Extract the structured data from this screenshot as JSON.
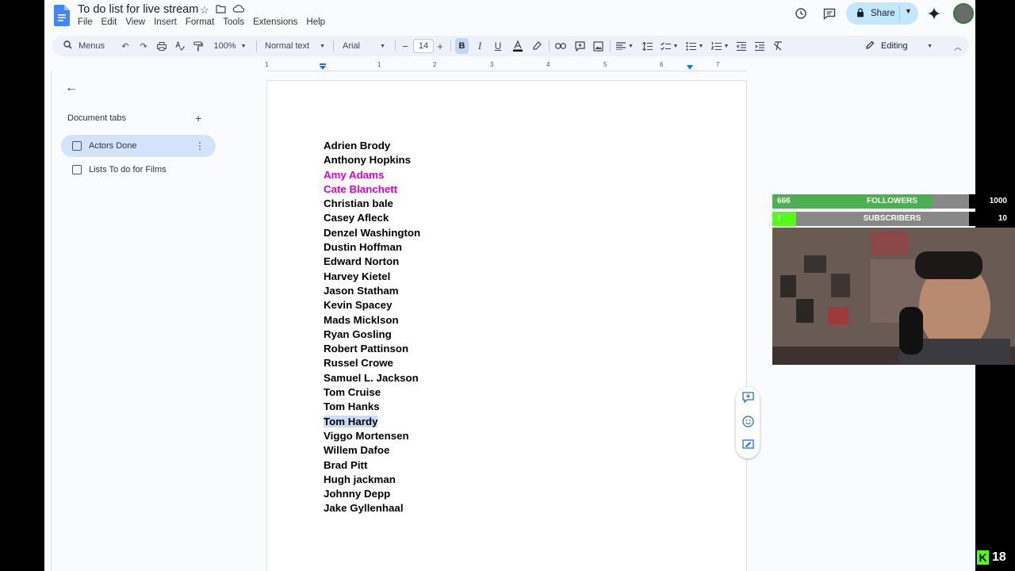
{
  "doc": {
    "title": "To do list for live stream",
    "menu": [
      "File",
      "Edit",
      "View",
      "Insert",
      "Format",
      "Tools",
      "Extensions",
      "Help"
    ]
  },
  "header": {
    "share_label": "Share"
  },
  "toolbar": {
    "search_label": "Menus",
    "zoom": "100%",
    "style": "Normal text",
    "font": "Arial",
    "font_size": "14",
    "mode": "Editing"
  },
  "ruler": {
    "ticks": [
      "1",
      "1",
      "2",
      "3",
      "4",
      "5",
      "6",
      "7"
    ]
  },
  "sidepanel": {
    "back": "←",
    "heading": "Document tabs",
    "add": "+",
    "tabs": [
      "Actors Done",
      "Lists To do for Films"
    ]
  },
  "content": {
    "actors": [
      {
        "name": "Adrien Brody",
        "color": "#000000"
      },
      {
        "name": "Anthony Hopkins",
        "color": "#000000"
      },
      {
        "name": "Amy Adams",
        "color": "#e000d4"
      },
      {
        "name": "Cate Blanchett",
        "color": "#e000d4"
      },
      {
        "name": "Christian bale",
        "color": "#000000"
      },
      {
        "name": "Casey Afleck",
        "color": "#000000"
      },
      {
        "name": "Denzel Washington",
        "color": "#000000"
      },
      {
        "name": "Dustin Hoffman",
        "color": "#000000"
      },
      {
        "name": "Edward Norton",
        "color": "#000000"
      },
      {
        "name": "Harvey Kietel",
        "color": "#000000"
      },
      {
        "name": "Jason Statham",
        "color": "#000000"
      },
      {
        "name": "Kevin Spacey",
        "color": "#000000"
      },
      {
        "name": "Mads Micklson",
        "color": "#000000"
      },
      {
        "name": "Ryan Gosling",
        "color": "#000000"
      },
      {
        "name": "Robert Pattinson",
        "color": "#000000"
      },
      {
        "name": "Russel Crowe",
        "color": "#000000"
      },
      {
        "name": "Samuel L. Jackson",
        "color": "#000000"
      },
      {
        "name": "Tom Cruise",
        "color": "#000000"
      },
      {
        "name": "Tom Hanks",
        "color": "#000000"
      },
      {
        "name": "Tom Hardy",
        "color": "#000000",
        "selected": true
      },
      {
        "name": "Viggo Mortensen",
        "color": "#000000"
      },
      {
        "name": "Willem Dafoe",
        "color": "#000000"
      },
      {
        "name": "Brad Pitt",
        "color": "#000000"
      },
      {
        "name": "Hugh jackman",
        "color": "#000000"
      },
      {
        "name": "Johnny Depp",
        "color": "#000000"
      },
      {
        "name": "Jake Gyllenhaal",
        "color": "#000000"
      }
    ]
  },
  "overlay": {
    "followers": {
      "current": "666",
      "label": "FOLLOWERS",
      "goal": "1000",
      "progress": 0.666
    },
    "subscribers": {
      "current": "1",
      "label": "SUBSCRIBERS",
      "goal": "10",
      "progress": 0.1
    },
    "viewer_count": "18",
    "brand_letter": "K"
  },
  "colors": {
    "accent": "#1a73e8",
    "share_bg": "#c2e7ff",
    "magenta": "#e000d4",
    "selection": "#c9dbf6",
    "bar_fill": "#4caf50"
  }
}
